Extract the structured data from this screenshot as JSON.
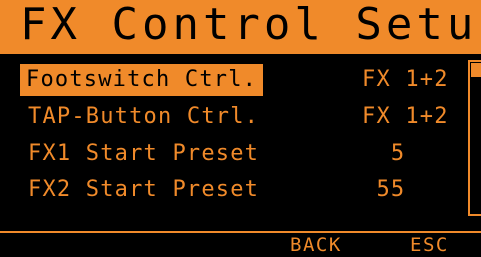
{
  "colors": {
    "background": "#000000",
    "accent": "#f08a2a"
  },
  "title": "FX Control Setup",
  "menu": {
    "items": [
      {
        "label": "Footswitch Ctrl.",
        "value": "FX 1+2",
        "selected": true
      },
      {
        "label": "TAP-Button Ctrl.",
        "value": "FX 1+2",
        "selected": false
      },
      {
        "label": "FX1 Start Preset",
        "value": "  5",
        "selected": false
      },
      {
        "label": "FX2 Start Preset",
        "value": " 55",
        "selected": false
      }
    ]
  },
  "softkeys": {
    "back": "BACK",
    "esc": "ESC"
  }
}
